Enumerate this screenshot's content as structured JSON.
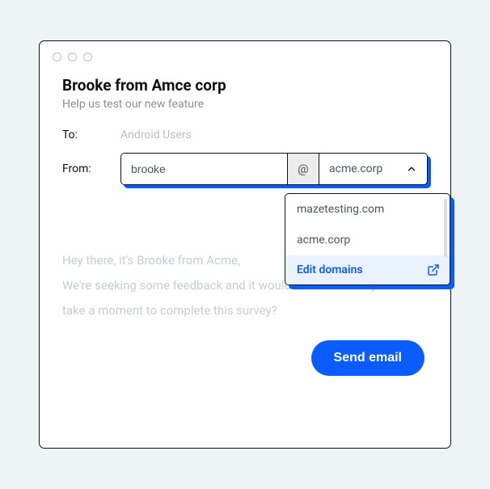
{
  "header": {
    "title": "Brooke from Amce corp",
    "subtitle": "Help us test our new feature"
  },
  "fields": {
    "to_label": "To:",
    "to_placeholder": "Android Users",
    "from_label": "From:",
    "from_local": "brooke",
    "at_symbol": "@",
    "from_domain": "acme.corp"
  },
  "domain_dropdown": {
    "options": [
      "mazetesting.com",
      "acme.corp"
    ],
    "edit_label": "Edit domains"
  },
  "body": {
    "line1": "Hey there, it's Brooke from Acme,",
    "line2": "We're seeking some feedback and it would be fantastic if you could take a moment to complete this survey?"
  },
  "actions": {
    "send": "Send email"
  },
  "colors": {
    "accent": "#0a5cff"
  }
}
